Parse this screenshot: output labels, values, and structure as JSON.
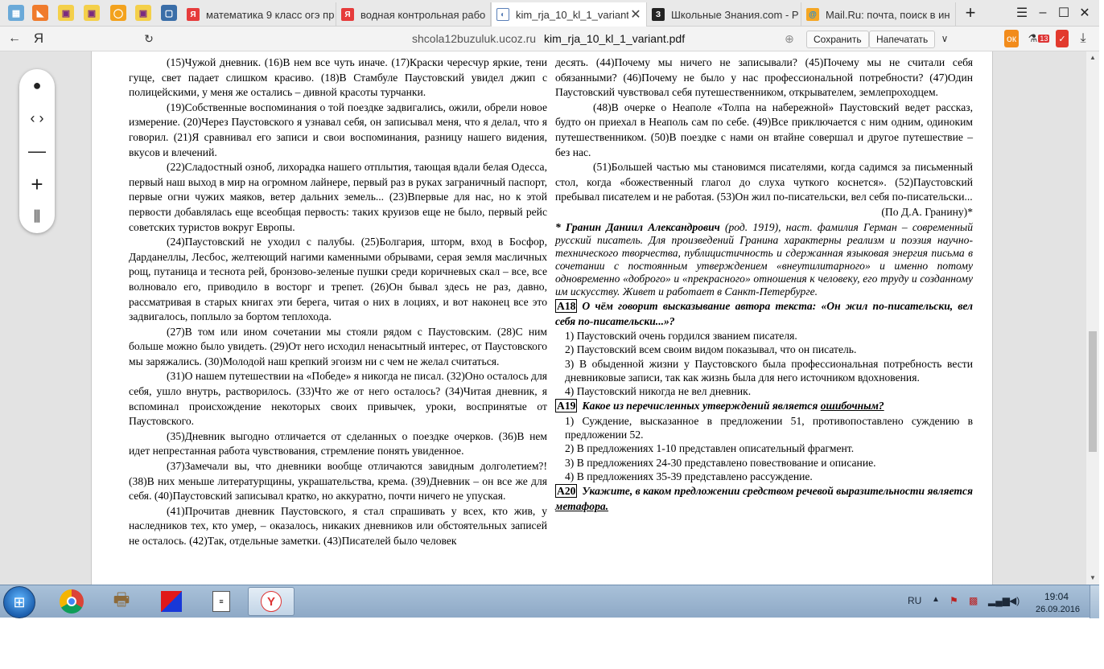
{
  "browser": {
    "tabs": [
      {
        "title": "математика 9 класс огэ пр",
        "icon": "yandex-y-icon",
        "color": "#e63b3b"
      },
      {
        "title": "водная контрольная рабо",
        "icon": "yandex-y-icon",
        "color": "#e63b3b"
      },
      {
        "title": "kim_rja_10_kl_1_variant.p",
        "icon": "pdf-icon",
        "color": "#5a7fb8"
      },
      {
        "title": "Школьные Знания.com - Р",
        "icon": "znanija-icon",
        "color": "#222222"
      },
      {
        "title": "Mail.Ru: почта, поиск в ин",
        "icon": "mailru-icon",
        "color": "#168de2"
      }
    ],
    "new_tab": "+",
    "address": {
      "domain": "shcola12buzuluk.ucoz.ru",
      "path": "kim_rja_10_kl_1_variant.pdf",
      "save_label": "Сохранить",
      "print_label": "Напечатать",
      "yandex_letter": "Я",
      "badge_count": "13"
    }
  },
  "document": {
    "left": [
      {
        "t": "(15)Чужой дневник. (16)В нем все чуть иначе. (17)Краски чересчур яркие, тени гуще, свет падает слишком красиво. (18)В Стамбуле Паустовский увидел джип с полицейскими, у меня же остались – дивной красоты турчанки."
      },
      {
        "t": "(19)Собственные воспоминания о той поездке задвигались, ожили, обрели новое измерение. (20)Через Паустовского я узнавал себя, он записывал меня, что я делал, что я говорил. (21)Я сравнивал его записи  и свои воспоминания, разницу нашего видения, вкусов и влечений."
      },
      {
        "t": "(22)Сладостный озноб, лихорадка нашего отплытия, тающая вдали белая Одесса, первый наш выход в мир на огромном лайнере, первый раз в руках заграничный паспорт, первые огни чужих маяков, ветер дальних земель... (23)Впервые для нас, но к этой первости добавлялась еще всеобщая первость: таких круизов еще не было, первый рейс советских туристов вокруг Европы."
      },
      {
        "t": "(24)Паустовский не уходил с палубы. (25)Болгария, шторм, вход в Босфор, Дарданеллы, Лесбос, желтеющий нагими каменными обрывами, серая земля масличных рощ, путаница и теснота рей, бронзово-зеленые пушки среди коричневых скал – все, все волновало его, приводило в восторг и трепет. (26)Он бывал здесь не раз, давно, рассматривая в старых книгах эти берега, читая о них в лоциях, и вот наконец все это задвигалось, поплыло за бортом теплохода."
      },
      {
        "t": "(27)В том или ином сочетании мы стояли рядом с Паустовским. (28)С ним больше можно было увидеть. (29)От него исходил ненасытный интерес, от Паустовского мы заряжались. (30)Молодой наш крепкий эгоизм ни с чем не желал считаться."
      },
      {
        "t": "(31)О нашем путешествии на «Победе» я никогда не писал. (32)Оно осталось для себя, ушло внутрь, растворилось. (33)Что же от него осталось? (34)Читая дневник, я вспоминал происхождение некоторых своих привычек, уроки, воспринятые от Паустовского."
      },
      {
        "t": "(35)Дневник выгодно отличается от сделанных о поездке очерков. (36)В нем идет непрестанная работа чувствования, стремление понять увиденное."
      },
      {
        "t": " (37)Замечали вы, что дневники вообще отличаются завидным долголетием?! (38)В них меньше литературщины, украшательства, крема. (39)Дневник – он все же для себя. (40)Паустовский записывал кратко, но аккуратно, почти ничего не упуская."
      },
      {
        "t": "(41)Прочитав дневник Паустовского, я стал спрашивать у всех, кто жив, у наследников тех, кто умер, – оказалось, никаких дневников или обстоятельных записей не осталось. (42)Так, отдельные заметки. (43)Писателей было человек"
      }
    ],
    "right_top": [
      {
        "t": "десять. (44)Почему мы ничего не записывали? (45)Почему мы не считали себя обязанными? (46)Почему не было у нас профессиональной потребности? (47)Один Паустовский чувствовал себя путешественником, открывателем, землепроходцем.",
        "noindent": true
      },
      {
        "t": "(48)В очерке о Неаполе «Толпа на набережной» Паустовский ведет рассказ, будто он приехал в Неаполь сам по себе. (49)Все приключается с ним одним, одиноким путешественником. (50)В поездке с нами он втайне совершал и другое путешествие – без нас."
      },
      {
        "t": "(51)Большей частью мы становимся писателями, когда садимся за письменный стол, когда «божественный глагол до слуха чуткого коснется». (52)Паустовский пребывал писателем и не работая. (53)Он жил по-писательски, вел себя по-писательски..."
      }
    ],
    "signature": "(По Д.А. Гранину)*",
    "footnote_bold": "* Гранин Даниил Александрович",
    "footnote_rest": " (род. 1919), наст. фамилия Герман – современный русский писатель. Для произведений Гранина характерны реализм и поэзия научно-технического творчества, публицистичность и сдержанная языковая энергия письма в сочетании с постоянным утверждением «внеутилитарного» и именно потому одновременно «доброго» и «прекрасного» отношения к человеку, его труду и созданному им искусству. Живет и работает в Санкт-Петербурге.",
    "a18": {
      "label": "А18",
      "question": "О чём говорит высказывание автора текста: «Он  жил  по-писательски, вел   себя по-писательски...»?",
      "options": [
        "1)  Паустовский очень гордился званием писателя.",
        "2)  Паустовский всем своим видом показывал, что он писатель.",
        "3)  В обыденной жизни у Паустовского была профессиональная потребность вести дневниковые записи, так как жизнь была для него источником вдохновения.",
        "4)  Паустовский никогда не вел дневник."
      ]
    },
    "a19": {
      "label": "А19",
      "question_pre": "Какое из перечисленных утверждений является ",
      "question_ul": "ошибочным?",
      "options": [
        "1)  Суждение, высказанное в предложении 51, противопоставлено суждению в предложении 52.",
        "2)   В предложениях 1-10 представлен описательный фрагмент.",
        "3)   В предложениях 24-30 представлено повествование и описание.",
        "4)   В предложениях 35-39 представлено рассуждение."
      ]
    },
    "a20": {
      "label": "А20",
      "question_pre": "Укажите, в каком предложении средством речевой выразительности является ",
      "question_ul": "метафора."
    }
  },
  "taskbar": {
    "lang": "RU",
    "time": "19:04",
    "date": "26.09.2016"
  }
}
